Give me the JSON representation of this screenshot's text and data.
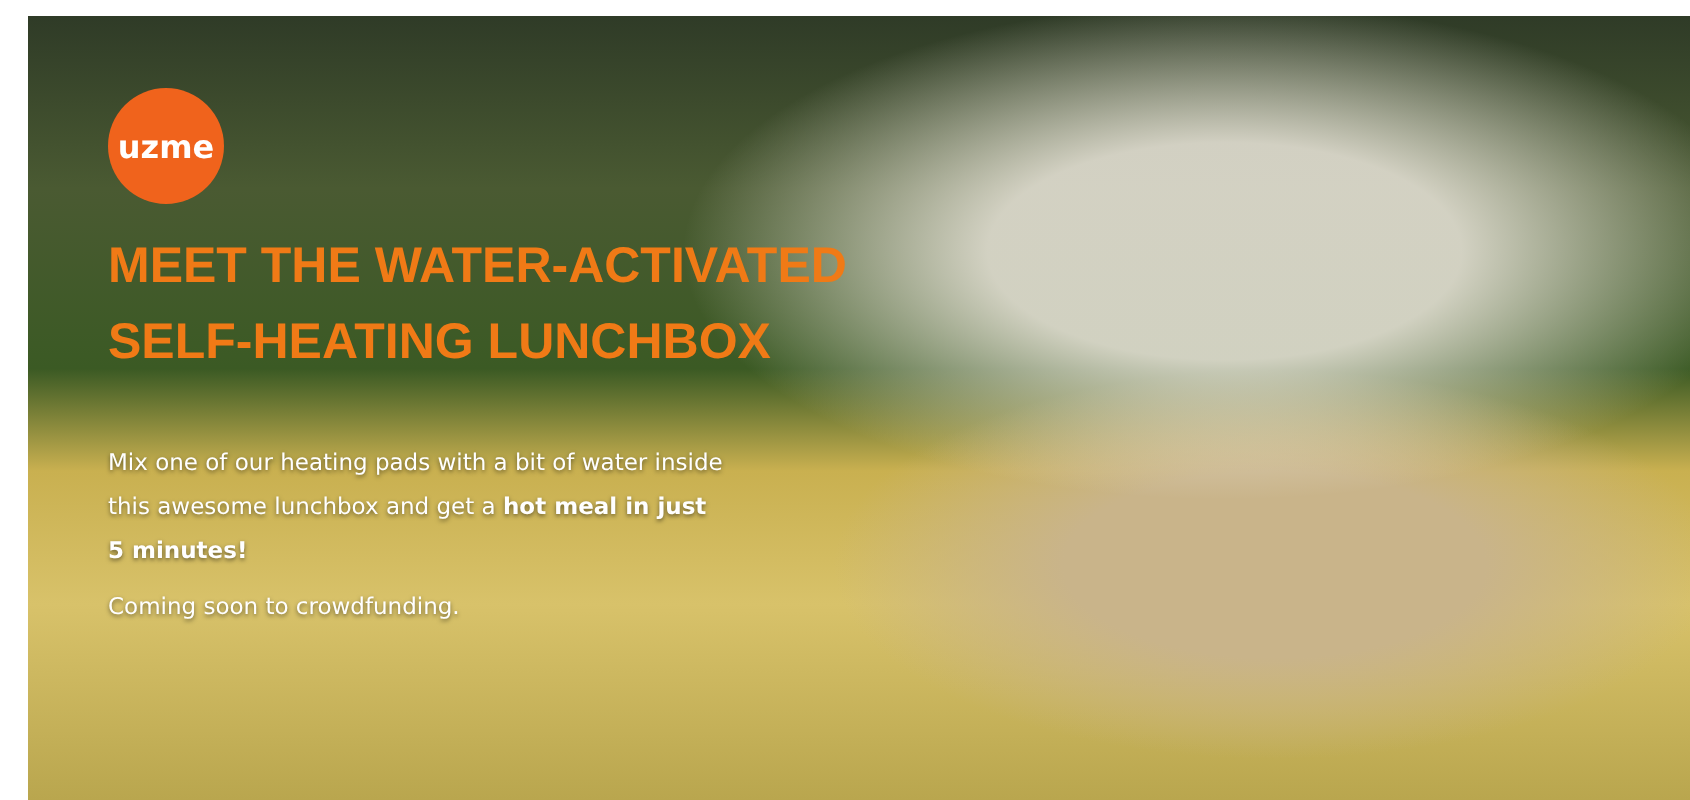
{
  "logo": {
    "text": "uzme"
  },
  "headline": [
    "MEET THE WATER-ACTIVATED",
    "SELF-HEATING LUNCHBOX"
  ],
  "description": "Mix one of our heating pads with a bit of water inside this awesome lunchbox and get a **hot meal in just 5 minutes!**",
  "note": "Coming soon to crowdfunding."
}
